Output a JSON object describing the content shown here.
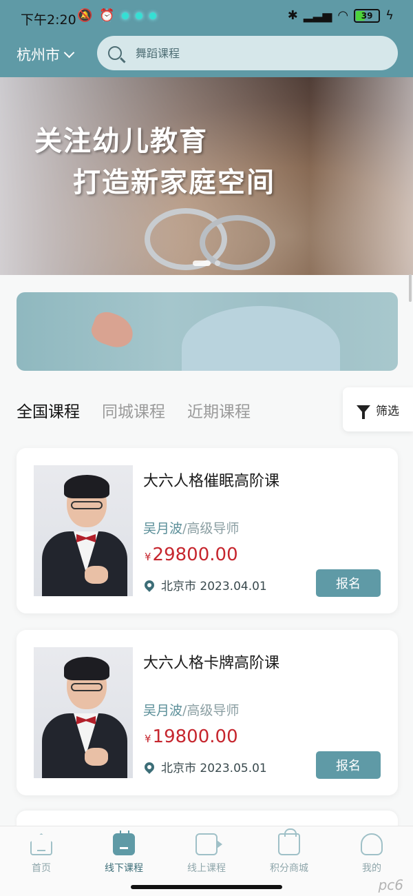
{
  "status_bar": {
    "time": "下午2:20",
    "battery": "39"
  },
  "header": {
    "city": "杭州市",
    "search_placeholder": "舞蹈课程"
  },
  "banner": {
    "line1": "关注幼儿教育",
    "line2": "打造新家庭空间"
  },
  "tabs": [
    {
      "label": "全国课程",
      "active": true
    },
    {
      "label": "同城课程",
      "active": false
    },
    {
      "label": "近期课程",
      "active": false
    }
  ],
  "filter_label": "筛选",
  "courses": [
    {
      "title": "大六人格催眠高阶课",
      "teacher": "吴月波",
      "role": "/高级导师",
      "currency": "¥",
      "price": "29800.00",
      "location": "北京市 2023.04.01",
      "button": "报名"
    },
    {
      "title": "大六人格卡牌高阶课",
      "teacher": "吴月波",
      "role": "/高级导师",
      "currency": "¥",
      "price": "19800.00",
      "location": "北京市 2023.05.01",
      "button": "报名"
    }
  ],
  "nav": [
    {
      "label": "首页",
      "icon": "home-icon"
    },
    {
      "label": "线下课程",
      "icon": "calendar-icon",
      "active": true
    },
    {
      "label": "线上课程",
      "icon": "video-icon"
    },
    {
      "label": "积分商城",
      "icon": "shopping-bag-icon"
    },
    {
      "label": "我的",
      "icon": "user-icon"
    }
  ],
  "watermark": "pc6",
  "colors": {
    "primary": "#5f9aa6",
    "price": "#c6262e",
    "teacher": "#5b8f99"
  }
}
